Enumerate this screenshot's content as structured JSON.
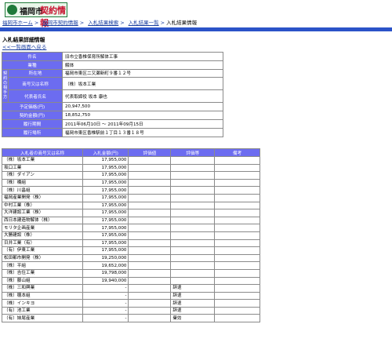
{
  "header": {
    "logo_city": "福岡市",
    "logo_title": "契約情報"
  },
  "breadcrumb": [
    {
      "label": "福岡市ホーム",
      "link": true
    },
    {
      "label": "福岡市契約情報",
      "link": true
    },
    {
      "label": "入札結果検索",
      "link": true
    },
    {
      "label": "入札結果一覧",
      "link": true
    },
    {
      "label": "入札結果情報",
      "link": false
    }
  ],
  "page": {
    "title": "入札結果詳細情報",
    "back_label": "<<一覧画面へ戻る"
  },
  "detail": {
    "case_label": "件名",
    "case_value": "旧市立香椎保育所解体工事",
    "type_label": "業種",
    "type_value": "解体",
    "group_label": "契約の相手方",
    "address_label": "所在地",
    "address_value": "福岡市東区二又瀬新町９番１２号",
    "company_label": "商号又は名称",
    "company_value": "（株）坂本工業",
    "rep_label": "代表者氏名",
    "rep_value": "代表取締役 坂本 康也",
    "est_label": "予定価格(円)",
    "est_value": "20,947,500",
    "contract_label": "契約金額(円)",
    "contract_value": "18,852,750",
    "period_label": "履行期間",
    "period_value": "2011年06月10日 ～ 2011年09月15日",
    "place_label": "履行場所",
    "place_value": "福岡市東区香椎駅前１丁目１３番１８号"
  },
  "bids": {
    "headers": [
      "入札者の商号又は名称",
      "入札金額(円)",
      "評価値",
      "評価等",
      "備考"
    ],
    "rows": [
      [
        "（株）坂本工業",
        "17,955,000",
        "",
        "",
        ""
      ],
      [
        "坂口工業",
        "17,955,000",
        "",
        "",
        ""
      ],
      [
        "（株）ダイアン",
        "17,955,000",
        "",
        "",
        ""
      ],
      [
        "（株）橋組",
        "17,955,000",
        "",
        "",
        ""
      ],
      [
        "（株）川畠組",
        "17,955,000",
        "",
        "",
        ""
      ],
      [
        "福岡産業開発（株）",
        "17,955,000",
        "",
        "",
        ""
      ],
      [
        "中村工業（株）",
        "17,955,000",
        "",
        "",
        ""
      ],
      [
        "大洋建設工業（株）",
        "17,955,000",
        "",
        "",
        ""
      ],
      [
        "西日本建造物解体（株）",
        "17,955,000",
        "",
        "",
        ""
      ],
      [
        "モリタ企画産業",
        "17,955,000",
        "",
        "",
        ""
      ],
      [
        "大勝建設（株）",
        "17,955,000",
        "",
        "",
        ""
      ],
      [
        "日井工業（有）",
        "17,955,000",
        "",
        "",
        ""
      ],
      [
        "（有）伊東工業",
        "17,955,000",
        "",
        "",
        ""
      ],
      [
        "松田都市開発（株）",
        "19,250,000",
        "",
        "",
        ""
      ],
      [
        "（株）平組",
        "19,652,000",
        "",
        "",
        ""
      ],
      [
        "（株）吉住工業",
        "19,798,000",
        "",
        "",
        ""
      ],
      [
        "（株）藤山組",
        "19,940,000",
        "",
        "",
        ""
      ],
      [
        "（株）三和興業",
        "-",
        "",
        "辞退",
        ""
      ],
      [
        "（株）穂本組",
        "-",
        "",
        "辞退",
        ""
      ],
      [
        "（株）インキヨ",
        "-",
        "",
        "辞退",
        ""
      ],
      [
        "（有）池工業",
        "-",
        "",
        "辞退",
        ""
      ],
      [
        "（有）妹尾産業",
        "-",
        "",
        "棄効",
        ""
      ]
    ]
  }
}
